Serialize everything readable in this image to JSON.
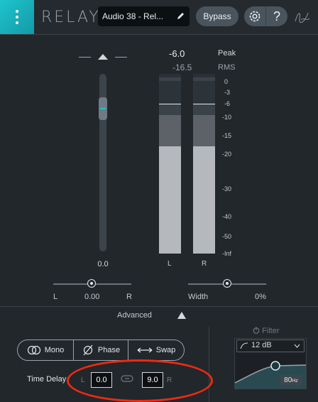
{
  "header": {
    "app_name": "RELAY",
    "preset_name": "Audio 38 - Rel...",
    "bypass_label": "Bypass",
    "help_label": "?"
  },
  "gain": {
    "value_label": "0.0"
  },
  "meters": {
    "peak_value": "-6.0",
    "peak_label": "Peak",
    "rms_value": "-16.5",
    "rms_label": "RMS",
    "scale": [
      "0",
      "-3",
      "-6",
      "-10",
      "-15",
      "-20",
      "-30",
      "-40",
      "-50",
      "-Inf"
    ],
    "left_label": "L",
    "right_label": "R"
  },
  "pan": {
    "left_label": "L",
    "value": "0.00",
    "right_label": "R"
  },
  "width": {
    "label": "Width",
    "value": "0%"
  },
  "advanced": {
    "label": "Advanced"
  },
  "modes": {
    "mono_label": "Mono",
    "phase_label": "Phase",
    "swap_label": "Swap"
  },
  "time_delay": {
    "label": "Time Delay",
    "l_label": "L",
    "l_value": "0.0",
    "r_value": "9.0",
    "r_label": "R"
  },
  "filter": {
    "label": "Filter",
    "slope": "12 dB",
    "frequency": "80",
    "frequency_unit": "Hz"
  },
  "colors": {
    "accent": "#1fc4cc",
    "annotation": "#ee2a10",
    "background": "#22272c"
  }
}
